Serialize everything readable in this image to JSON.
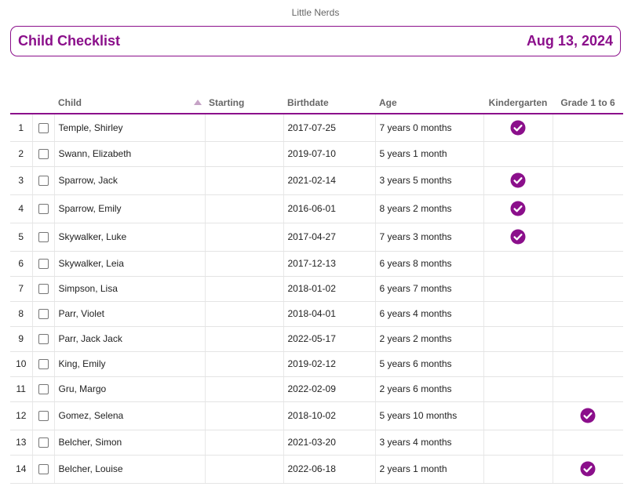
{
  "app": {
    "org_name": "Little Nerds"
  },
  "header": {
    "title": "Child Checklist",
    "date": "Aug 13, 2024"
  },
  "table": {
    "columns": {
      "child": "Child",
      "starting": "Starting",
      "birthdate": "Birthdate",
      "age": "Age",
      "kindergarten": "Kindergarten",
      "grade": "Grade 1 to 6"
    },
    "sort": {
      "column": "child",
      "direction": "ascending"
    },
    "rows": [
      {
        "num": "1",
        "name": "Temple, Shirley",
        "starting": "",
        "birthdate": "2017-07-25",
        "age": "7 years 0 months",
        "kindergarten": true,
        "grade": false,
        "selected": false
      },
      {
        "num": "2",
        "name": "Swann, Elizabeth",
        "starting": "",
        "birthdate": "2019-07-10",
        "age": "5 years 1 month",
        "kindergarten": false,
        "grade": false,
        "selected": false
      },
      {
        "num": "3",
        "name": "Sparrow, Jack",
        "starting": "",
        "birthdate": "2021-02-14",
        "age": "3 years 5 months",
        "kindergarten": true,
        "grade": false,
        "selected": false
      },
      {
        "num": "4",
        "name": "Sparrow, Emily",
        "starting": "",
        "birthdate": "2016-06-01",
        "age": "8 years 2 months",
        "kindergarten": true,
        "grade": false,
        "selected": false
      },
      {
        "num": "5",
        "name": "Skywalker, Luke",
        "starting": "",
        "birthdate": "2017-04-27",
        "age": "7 years 3 months",
        "kindergarten": true,
        "grade": false,
        "selected": false
      },
      {
        "num": "6",
        "name": "Skywalker, Leia",
        "starting": "",
        "birthdate": "2017-12-13",
        "age": "6 years 8 months",
        "kindergarten": false,
        "grade": false,
        "selected": false
      },
      {
        "num": "7",
        "name": "Simpson, Lisa",
        "starting": "",
        "birthdate": "2018-01-02",
        "age": "6 years 7 months",
        "kindergarten": false,
        "grade": false,
        "selected": false
      },
      {
        "num": "8",
        "name": "Parr, Violet",
        "starting": "",
        "birthdate": "2018-04-01",
        "age": "6 years 4 months",
        "kindergarten": false,
        "grade": false,
        "selected": false
      },
      {
        "num": "9",
        "name": "Parr, Jack Jack",
        "starting": "",
        "birthdate": "2022-05-17",
        "age": "2 years 2 months",
        "kindergarten": false,
        "grade": false,
        "selected": false
      },
      {
        "num": "10",
        "name": "King, Emily",
        "starting": "",
        "birthdate": "2019-02-12",
        "age": "5 years 6 months",
        "kindergarten": false,
        "grade": false,
        "selected": false
      },
      {
        "num": "11",
        "name": "Gru, Margo",
        "starting": "",
        "birthdate": "2022-02-09",
        "age": "2 years 6 months",
        "kindergarten": false,
        "grade": false,
        "selected": false
      },
      {
        "num": "12",
        "name": "Gomez, Selena",
        "starting": "",
        "birthdate": "2018-10-02",
        "age": "5 years 10 months",
        "kindergarten": false,
        "grade": true,
        "selected": false
      },
      {
        "num": "13",
        "name": "Belcher, Simon",
        "starting": "",
        "birthdate": "2021-03-20",
        "age": "3 years 4 months",
        "kindergarten": false,
        "grade": false,
        "selected": false
      },
      {
        "num": "14",
        "name": "Belcher, Louise",
        "starting": "",
        "birthdate": "2022-06-18",
        "age": "2 years 1 month",
        "kindergarten": false,
        "grade": true,
        "selected": false
      }
    ]
  },
  "icons": {
    "check": "check-circle-icon",
    "sort": "sort-ascending-icon"
  },
  "colors": {
    "accent": "#8b0f8b",
    "sort_indicator": "#c6a3c6"
  }
}
